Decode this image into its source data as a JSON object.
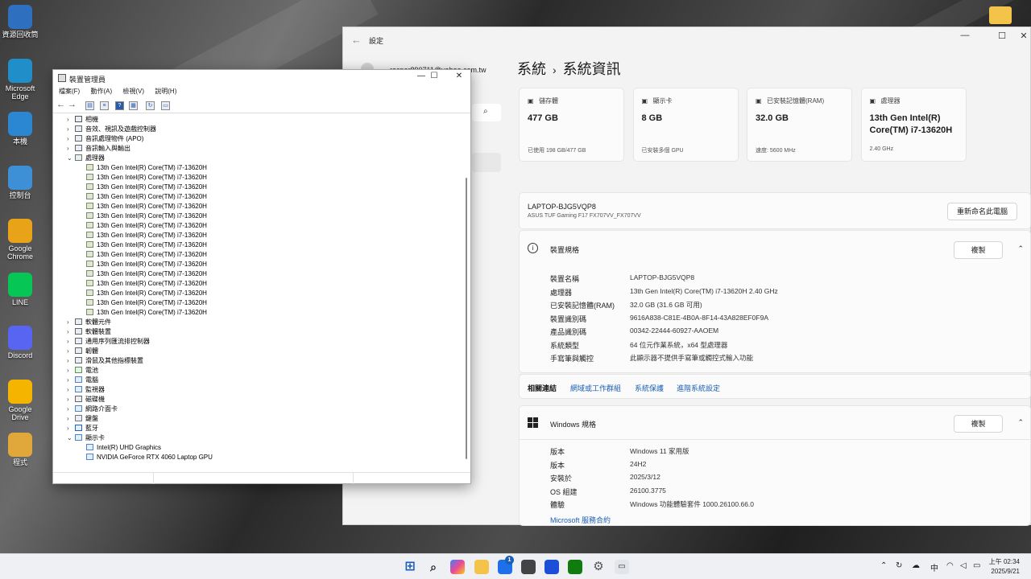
{
  "desktop": {
    "icons": [
      {
        "label": "資源回收筒",
        "icon": "recycle-bin-icon"
      },
      {
        "label": "Microsoft Edge",
        "icon": "edge-icon"
      },
      {
        "label": "本機",
        "icon": "this-pc-icon"
      },
      {
        "label": "控制台",
        "icon": "control-panel-icon"
      },
      {
        "label": "Google Chrome",
        "icon": "chrome-icon"
      },
      {
        "label": "LINE",
        "icon": "line-icon"
      },
      {
        "label": "Discord",
        "icon": "discord-icon"
      },
      {
        "label": "Google Drive",
        "icon": "google-drive-icon"
      },
      {
        "label": "程式",
        "icon": "folder-icon"
      }
    ]
  },
  "settings": {
    "window_title": "設定",
    "email": "rasper890711@yahoo.com.tw",
    "breadcrumb": {
      "parent": "系統",
      "current": "系統資訊"
    },
    "cards": [
      {
        "label": "儲存體",
        "value": "477 GB",
        "sub": "已使用 198 GB/477 GB"
      },
      {
        "label": "顯示卡",
        "value": "8 GB",
        "sub": "已安裝多個 GPU"
      },
      {
        "label": "已安裝記憶體(RAM)",
        "value": "32.0 GB",
        "sub": "速度: 5600 MHz"
      },
      {
        "label": "處理器",
        "value": "13th Gen Intel(R) Core(TM) i7-13620H",
        "sub": "2.40 GHz"
      }
    ],
    "device": {
      "name": "LAPTOP-BJG5VQP8",
      "model": "ASUS TUF Gaming F17 FX707VV_FX707VV",
      "rename_button": "重新命名此電腦"
    },
    "device_specs": {
      "title": "裝置規格",
      "copy_button": "複製",
      "rows": [
        {
          "k": "裝置名稱",
          "v": "LAPTOP-BJG5VQP8"
        },
        {
          "k": "處理器",
          "v": "13th Gen Intel(R) Core(TM) i7-13620H   2.40 GHz"
        },
        {
          "k": "已安裝記憶體(RAM)",
          "v": "32.0 GB (31.6 GB 可用)"
        },
        {
          "k": "裝置識別碼",
          "v": "9616A838-C81E-4B0A-8F14-43A828EF0F9A"
        },
        {
          "k": "產品識別碼",
          "v": "00342-22444-60927-AAOEM"
        },
        {
          "k": "系統類型",
          "v": "64 位元作業系統，x64 型處理器"
        },
        {
          "k": "手寫筆與觸控",
          "v": "此顯示器不提供手寫筆或觸控式輸入功能"
        }
      ]
    },
    "related_links": {
      "title": "相關連結",
      "links": [
        "網域或工作群組",
        "系統保護",
        "進階系統設定"
      ]
    },
    "windows_specs": {
      "title": "Windows 規格",
      "copy_button": "複製",
      "rows": [
        {
          "k": "版本",
          "v": "Windows 11 家用版"
        },
        {
          "k": "版本",
          "v": "24H2"
        },
        {
          "k": "安裝於",
          "v": "2025/3/12"
        },
        {
          "k": "OS 組建",
          "v": "26100.3775"
        },
        {
          "k": "體驗",
          "v": "Windows 功能體驗套件 1000.26100.66.0"
        }
      ],
      "link": "Microsoft 服務合約"
    }
  },
  "device_manager": {
    "title": "裝置管理員",
    "menu": [
      "檔案(F)",
      "動作(A)",
      "檢視(V)",
      "說明(H)"
    ],
    "tree": [
      {
        "label": "相機",
        "exp": ">",
        "level": 0,
        "icon": "camera-icon"
      },
      {
        "label": "音效、視訊及遊戲控制器",
        "exp": ">",
        "level": 0,
        "icon": "sound-icon"
      },
      {
        "label": "音訊處理物件 (APO)",
        "exp": ">",
        "level": 0,
        "icon": "audio-icon"
      },
      {
        "label": "音訊輸入與輸出",
        "exp": ">",
        "level": 0,
        "icon": "audio-io-icon"
      },
      {
        "label": "處理器",
        "exp": "v",
        "level": 0,
        "icon": "processor-icon"
      },
      {
        "label": "13th Gen Intel(R) Core(TM) i7-13620H",
        "exp": "",
        "level": 1,
        "icon": "cpu-icon"
      },
      {
        "label": "13th Gen Intel(R) Core(TM) i7-13620H",
        "exp": "",
        "level": 1,
        "icon": "cpu-icon"
      },
      {
        "label": "13th Gen Intel(R) Core(TM) i7-13620H",
        "exp": "",
        "level": 1,
        "icon": "cpu-icon"
      },
      {
        "label": "13th Gen Intel(R) Core(TM) i7-13620H",
        "exp": "",
        "level": 1,
        "icon": "cpu-icon"
      },
      {
        "label": "13th Gen Intel(R) Core(TM) i7-13620H",
        "exp": "",
        "level": 1,
        "icon": "cpu-icon"
      },
      {
        "label": "13th Gen Intel(R) Core(TM) i7-13620H",
        "exp": "",
        "level": 1,
        "icon": "cpu-icon"
      },
      {
        "label": "13th Gen Intel(R) Core(TM) i7-13620H",
        "exp": "",
        "level": 1,
        "icon": "cpu-icon"
      },
      {
        "label": "13th Gen Intel(R) Core(TM) i7-13620H",
        "exp": "",
        "level": 1,
        "icon": "cpu-icon"
      },
      {
        "label": "13th Gen Intel(R) Core(TM) i7-13620H",
        "exp": "",
        "level": 1,
        "icon": "cpu-icon"
      },
      {
        "label": "13th Gen Intel(R) Core(TM) i7-13620H",
        "exp": "",
        "level": 1,
        "icon": "cpu-icon"
      },
      {
        "label": "13th Gen Intel(R) Core(TM) i7-13620H",
        "exp": "",
        "level": 1,
        "icon": "cpu-icon"
      },
      {
        "label": "13th Gen Intel(R) Core(TM) i7-13620H",
        "exp": "",
        "level": 1,
        "icon": "cpu-icon"
      },
      {
        "label": "13th Gen Intel(R) Core(TM) i7-13620H",
        "exp": "",
        "level": 1,
        "icon": "cpu-icon"
      },
      {
        "label": "13th Gen Intel(R) Core(TM) i7-13620H",
        "exp": "",
        "level": 1,
        "icon": "cpu-icon"
      },
      {
        "label": "13th Gen Intel(R) Core(TM) i7-13620H",
        "exp": "",
        "level": 1,
        "icon": "cpu-icon"
      },
      {
        "label": "13th Gen Intel(R) Core(TM) i7-13620H",
        "exp": "",
        "level": 1,
        "icon": "cpu-icon"
      },
      {
        "label": "軟體元件",
        "exp": ">",
        "level": 0,
        "icon": "software-component-icon"
      },
      {
        "label": "軟體裝置",
        "exp": ">",
        "level": 0,
        "icon": "software-device-icon"
      },
      {
        "label": "通用序列匯流排控制器",
        "exp": ">",
        "level": 0,
        "icon": "usb-icon"
      },
      {
        "label": "韌體",
        "exp": ">",
        "level": 0,
        "icon": "firmware-icon"
      },
      {
        "label": "滑鼠及其他指標裝置",
        "exp": ">",
        "level": 0,
        "icon": "mouse-icon"
      },
      {
        "label": "電池",
        "exp": ">",
        "level": 0,
        "icon": "battery-icon"
      },
      {
        "label": "電腦",
        "exp": ">",
        "level": 0,
        "icon": "computer-icon"
      },
      {
        "label": "監視器",
        "exp": ">",
        "level": 0,
        "icon": "monitor-icon"
      },
      {
        "label": "磁碟機",
        "exp": ">",
        "level": 0,
        "icon": "disk-icon"
      },
      {
        "label": "網路介面卡",
        "exp": ">",
        "level": 0,
        "icon": "network-icon"
      },
      {
        "label": "鍵盤",
        "exp": ">",
        "level": 0,
        "icon": "keyboard-icon"
      },
      {
        "label": "藍牙",
        "exp": ">",
        "level": 0,
        "icon": "bluetooth-icon"
      },
      {
        "label": "顯示卡",
        "exp": "v",
        "level": 0,
        "icon": "display-adapter-icon"
      },
      {
        "label": "Intel(R) UHD Graphics",
        "exp": "",
        "level": 1,
        "icon": "gpu-icon"
      },
      {
        "label": "NVIDIA GeForce RTX 4060 Laptop GPU",
        "exp": "",
        "level": 1,
        "icon": "gpu-icon"
      }
    ]
  },
  "taskbar": {
    "apps": [
      "start-icon",
      "search-icon",
      "copilot-icon",
      "file-explorer-icon",
      "store-icon",
      "app-icon",
      "app-icon",
      "xbox-icon",
      "settings-icon",
      "device-manager-icon"
    ],
    "store_badge": "1",
    "tray_ime": "中",
    "time": "上午 02:34",
    "date": "2025/9/21"
  }
}
